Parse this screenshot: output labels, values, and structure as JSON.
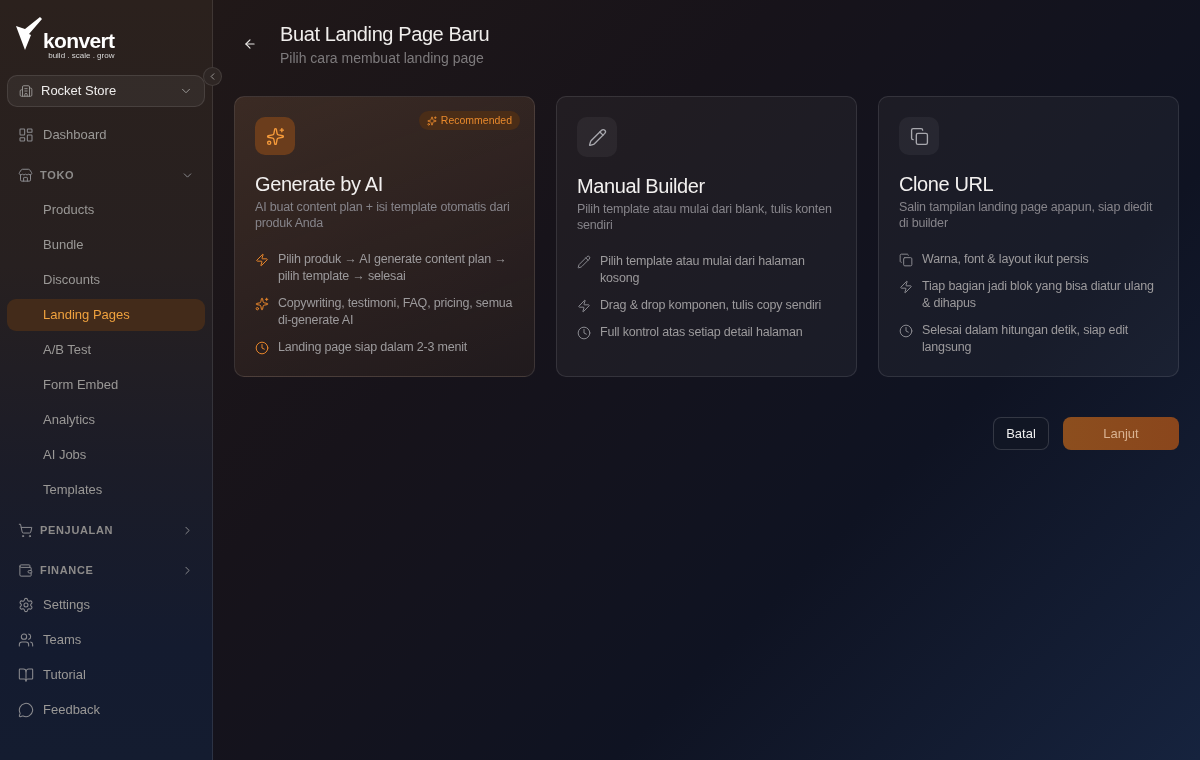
{
  "sidebar": {
    "logo": {
      "name": "konvert",
      "tagline": "build . scale . grow"
    },
    "store_selector": {
      "value": "Rocket Store"
    },
    "nav": [
      {
        "kind": "link",
        "label": "Dashboard",
        "selected": false
      },
      {
        "kind": "section",
        "label": "TOKO",
        "expanded": true,
        "children": [
          {
            "label": "Products",
            "selected": false
          },
          {
            "label": "Bundle",
            "selected": false
          },
          {
            "label": "Discounts",
            "selected": false
          },
          {
            "label": "Landing Pages",
            "selected": true
          },
          {
            "label": "A/B Test",
            "selected": false
          },
          {
            "label": "Form Embed",
            "selected": false
          },
          {
            "label": "Analytics",
            "selected": false
          },
          {
            "label": "AI Jobs",
            "selected": false
          },
          {
            "label": "Templates",
            "selected": false
          }
        ]
      },
      {
        "kind": "section",
        "label": "PENJUALAN",
        "expanded": false
      },
      {
        "kind": "section",
        "label": "FINANCE",
        "expanded": false
      },
      {
        "kind": "link",
        "label": "Settings",
        "selected": false
      },
      {
        "kind": "link",
        "label": "Teams",
        "selected": false
      },
      {
        "kind": "link",
        "label": "Tutorial",
        "selected": false
      },
      {
        "kind": "link",
        "label": "Feedback",
        "selected": false
      }
    ]
  },
  "header": {
    "title": "Buat Landing Page Baru",
    "subtitle": "Pilih cara membuat landing page"
  },
  "options": [
    {
      "kind": "featured",
      "title": "Generate by AI",
      "badge": "Recommended",
      "description": "AI buat content plan + isi template otomatis dari produk Anda",
      "features": [
        "Pilih produk → AI generate content plan → pilih template → selesai",
        "Copywriting, testimoni, FAQ, pricing, semua di-generate AI",
        "Landing page siap dalam 2-3 menit"
      ]
    },
    {
      "kind": "standard",
      "title": "Manual Builder",
      "description": "Pilih template atau mulai dari blank, tulis konten sendiri",
      "features": [
        "Pilih template atau mulai dari halaman kosong",
        "Drag & drop komponen, tulis copy sendiri",
        "Full kontrol atas setiap detail halaman"
      ]
    },
    {
      "kind": "standard",
      "title": "Clone URL",
      "description": "Salin tampilan landing page apapun, siap diedit di builder",
      "features": [
        "Warna, font & layout ikut persis",
        "Tiap bagian jadi blok yang bisa diatur ulang & dihapus",
        "Selesai dalam hitungan detik, siap edit langsung"
      ]
    }
  ],
  "buttons": [
    {
      "kind": "secondary",
      "label": "Batal",
      "disabled": false
    },
    {
      "kind": "primary",
      "label": "Lanjut",
      "disabled": true
    }
  ]
}
